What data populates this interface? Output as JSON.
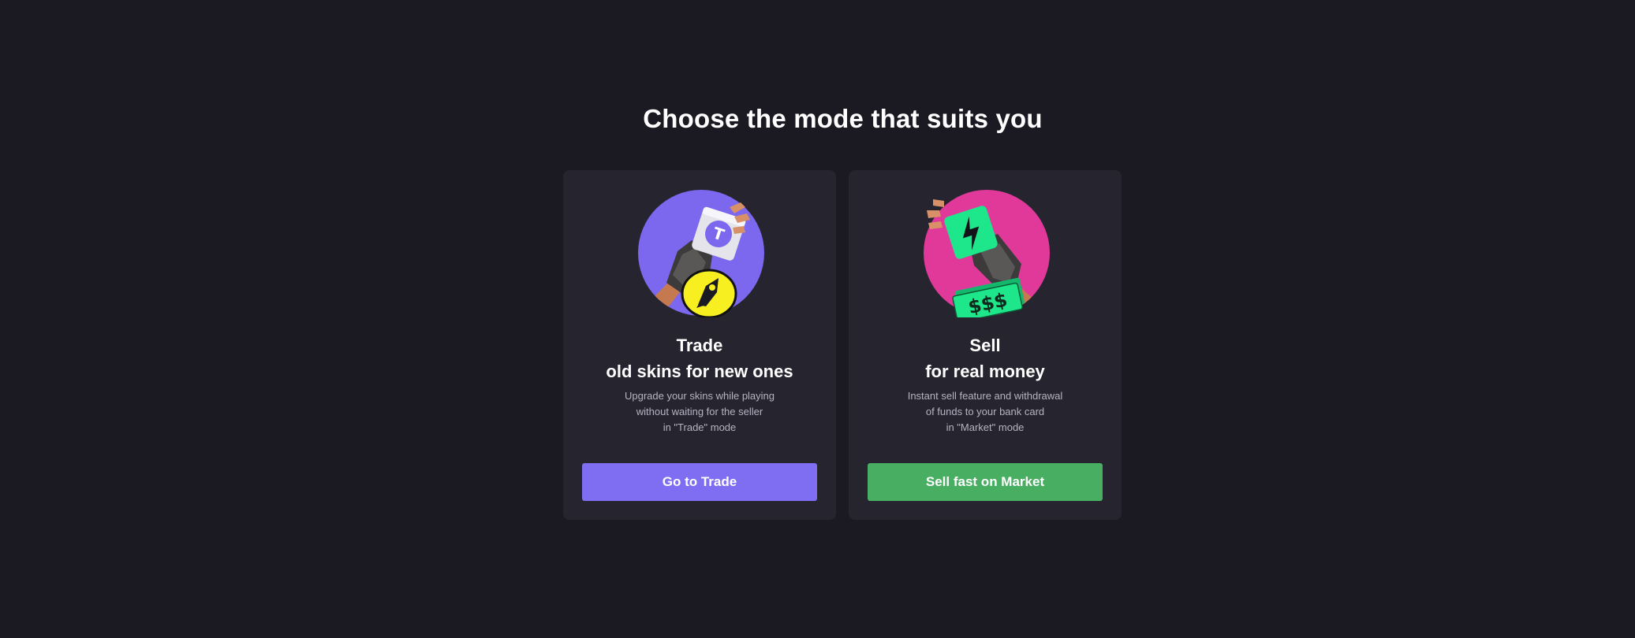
{
  "heading": "Choose the mode that suits you",
  "cards": [
    {
      "title_line1": "Trade",
      "title_line2": "old skins for new ones",
      "desc_line1": "Upgrade your skins while playing",
      "desc_line2": "without waiting for the seller",
      "desc_line3": "in \"Trade\" mode",
      "button": "Go to Trade",
      "accent": "#7f6ef2",
      "illustration": "gloved-hand-trade-token-rocket-icon",
      "token_letter": "T"
    },
    {
      "title_line1": "Sell",
      "title_line2": "for real money",
      "desc_line1": "Instant sell feature and withdrawal",
      "desc_line2": "of funds to your bank card",
      "desc_line3": "in \"Market\" mode",
      "button": "Sell fast on Market",
      "accent": "#48ae62",
      "illustration": "gloved-hand-lightning-card-cash-icon",
      "cash_text": "$$$"
    }
  ],
  "colors": {
    "background": "#1b1a22",
    "card": "#26252f",
    "trade_circle": "#7b68ee",
    "sell_circle": "#e0399a"
  }
}
